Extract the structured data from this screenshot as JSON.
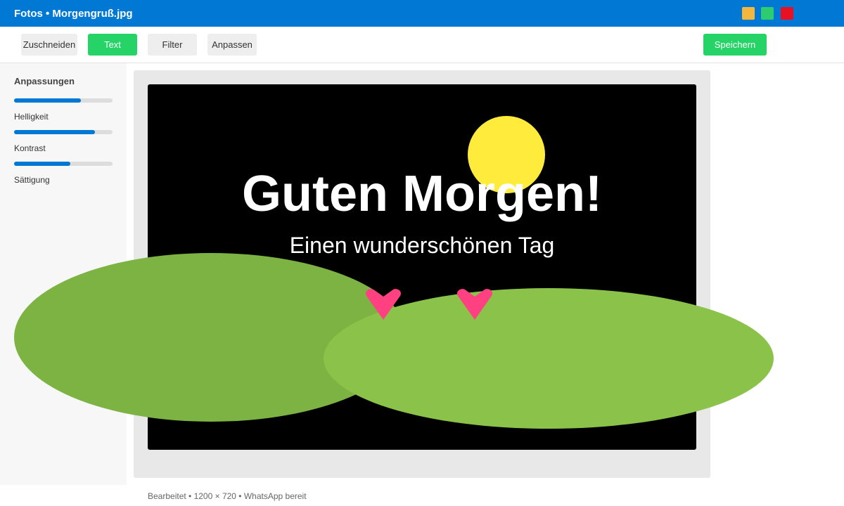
{
  "window": {
    "title": "Fotos • Morgengruß.jpg",
    "controls": [
      {
        "name": "minimize",
        "color": "#f4b63c"
      },
      {
        "name": "maximize",
        "color": "#2ecc71"
      },
      {
        "name": "close",
        "color": "#e81123"
      }
    ]
  },
  "toolbar": {
    "crop_label": "Zuschneiden",
    "text_label": "Text",
    "filter_label": "Filter",
    "adjust_label": "Anpassen",
    "save_label": "Speichern",
    "active_tool": "Text"
  },
  "sidebar": {
    "title": "Anpassungen",
    "sliders": [
      {
        "label": "Helligkeit",
        "value": 0.68
      },
      {
        "label": "Kontrast",
        "value": 0.82
      },
      {
        "label": "Sättigung",
        "value": 0.57
      }
    ]
  },
  "image": {
    "headline": "Guten Morgen!",
    "subline": "Einen wunderschönen Tag",
    "decorations": [
      "sun",
      "heart",
      "heart",
      "green-hill",
      "green-hill"
    ]
  },
  "status": {
    "text": "Bearbeitet • 1200 × 720 • WhatsApp bereit"
  },
  "colors": {
    "accent_blue": "#0078d4",
    "active_green": "#25d366",
    "button_gray": "#eeeeee",
    "slider_fill": "#0078d4",
    "sun_yellow": "#ffeb3b",
    "heart_pink": "#ff4081",
    "hill_dark": "#7cb342",
    "hill_light": "#8bc34a"
  }
}
